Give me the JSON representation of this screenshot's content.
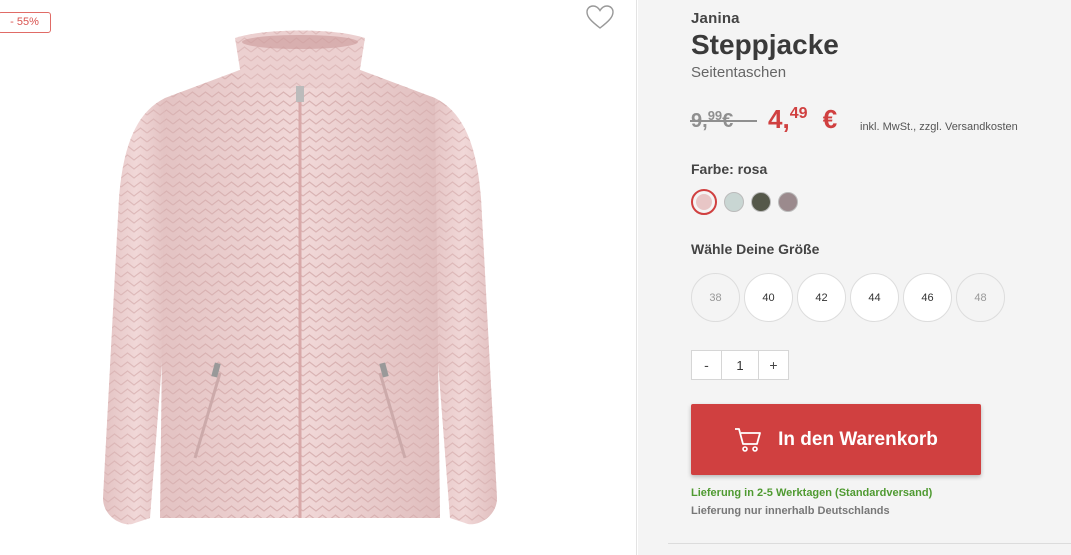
{
  "badge": {
    "discount": "- 55%"
  },
  "product": {
    "brand": "Janina",
    "title": "Steppjacke",
    "subtitle": "Seitentaschen"
  },
  "price": {
    "old_main": "9,",
    "old_cents": "99",
    "old_currency": "€",
    "new_main": "4,",
    "new_cents": "49",
    "new_currency": "€",
    "tax_note": "inkl. MwSt., zzgl. Versandkosten"
  },
  "color": {
    "label": "Farbe: rosa",
    "swatches": [
      {
        "name": "rosa",
        "hex": "#e8c6c6",
        "selected": true
      },
      {
        "name": "mint",
        "hex": "#c9d6d3",
        "selected": false
      },
      {
        "name": "olive",
        "hex": "#55584a",
        "selected": false
      },
      {
        "name": "mauve",
        "hex": "#9b8a8d",
        "selected": false
      }
    ]
  },
  "size": {
    "label": "Wähle Deine Größe",
    "options": [
      {
        "value": "38",
        "available": false
      },
      {
        "value": "40",
        "available": true
      },
      {
        "value": "42",
        "available": true
      },
      {
        "value": "44",
        "available": true
      },
      {
        "value": "46",
        "available": true
      },
      {
        "value": "48",
        "available": false
      }
    ]
  },
  "quantity": {
    "minus": "-",
    "value": "1",
    "plus": "+"
  },
  "cart": {
    "label": "In den Warenkorb",
    "icon": "cart-icon"
  },
  "delivery": {
    "time": "Lieferung in 2-5 Werktagen (Standardversand)",
    "note": "Lieferung nur innerhalb Deutschlands"
  },
  "colors": {
    "accent": "#d04040",
    "delivery_green": "#4f9a31"
  }
}
